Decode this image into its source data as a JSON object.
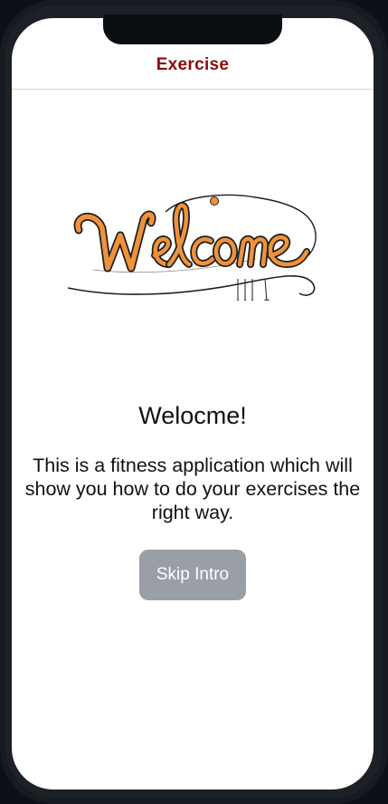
{
  "header": {
    "title": "Exercise"
  },
  "welcome_logo": {
    "text": "Welcome",
    "icon": "welcome-script-logo",
    "colors": {
      "fill": "#f0923a",
      "outline": "#1f1f1f"
    }
  },
  "main": {
    "heading": "Welocme!",
    "description": "This is a fitness application which will show you how to do your exercises the right way.",
    "skip_button_label": "Skip Intro"
  },
  "colors": {
    "header_title": "#8b0b0b",
    "button_bg": "#9a9ea6",
    "button_text": "#ffffff",
    "device_frame": "#161b22"
  }
}
